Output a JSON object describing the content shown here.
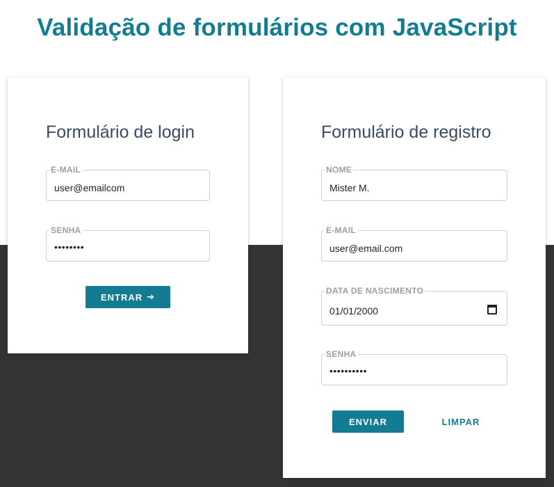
{
  "page": {
    "title": "Validação de formulários com JavaScript"
  },
  "login": {
    "title": "Formulário de login",
    "email_label": "E-MAIL",
    "email_value": "user@emailcom",
    "password_label": "SENHA",
    "password_value": "••••••••",
    "submit_label": "ENTRAR",
    "submit_icon": "arrow-right-icon"
  },
  "register": {
    "title": "Formulário de registro",
    "name_label": "NOME",
    "name_value": "Mister M.",
    "email_label": "E-MAIL",
    "email_value": "user@email.com",
    "birth_label": "DATA DE NASCIMENTO",
    "birth_value": "01/01/2000",
    "birth_icon": "calendar-icon",
    "password_label": "SENHA",
    "password_value": "••••••••••",
    "submit_label": "ENVIAR",
    "clear_label": "LIMPAR"
  },
  "colors": {
    "accent": "#137b92",
    "heading": "#3b4a63",
    "dark_bg": "#333333",
    "label": "#9e9e9e"
  }
}
